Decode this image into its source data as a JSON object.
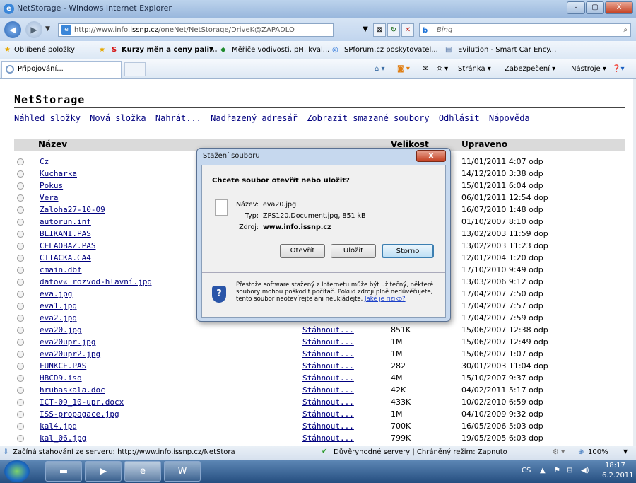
{
  "window": {
    "title": "NetStorage - Windows Internet Explorer",
    "min": "–",
    "max": "▢",
    "close": "X"
  },
  "address": {
    "url_prefix": "http://www.info.",
    "url_host": "issnp.cz",
    "url_path": "/oneNet/NetStorage/DriveK@ZAPADLO",
    "search_placeholder": "Bing"
  },
  "favorites": {
    "label": "Oblíbené položky",
    "items": [
      "Kurzy měn a ceny pali...",
      "Měřiče vodivosti, pH, kval...",
      "ISPforum.cz poskytovatel...",
      "Evilution - Smart Car Ency..."
    ]
  },
  "tab": {
    "label": "Připojování..."
  },
  "commandbar": {
    "page": "Stránka ▾",
    "security": "Zabezpečení ▾",
    "tools": "Nástroje ▾"
  },
  "page": {
    "title": "NetStorage",
    "links": [
      "Náhled složky",
      "Nová složka",
      "Nahrát...",
      "Nadřazený adresář",
      "Zobrazit smazané soubory",
      "Odhlásit",
      "Nápověda"
    ],
    "headers": {
      "name": "Název",
      "size": "Velikost",
      "modified": "Upraveno"
    },
    "download_label": "Stáhnout...",
    "rows": [
      {
        "name": "Cz",
        "size": "",
        "modified": "11/01/2011 4:07 odp"
      },
      {
        "name": "Kucharka",
        "size": "",
        "modified": "14/12/2010 3:38 odp"
      },
      {
        "name": "Pokus",
        "size": "",
        "modified": "15/01/2011 6:04 odp"
      },
      {
        "name": "Vera",
        "size": "",
        "modified": "06/01/2011 12:54 dop"
      },
      {
        "name": "Zaloha27-10-09",
        "size": "",
        "modified": "16/07/2010 1:48 odp"
      },
      {
        "name": "autorun.inf",
        "size": "",
        "modified": "01/10/2007 8:10 odp"
      },
      {
        "name": "BLIKANI.PAS",
        "size": "",
        "modified": "13/02/2003 11:59 dop"
      },
      {
        "name": "CELAOBAZ.PAS",
        "size": "",
        "modified": "13/02/2003 11:23 dop"
      },
      {
        "name": "CITACKA.CA4",
        "size": "",
        "modified": "12/01/2004 1:20 dop"
      },
      {
        "name": "cmain.dbf",
        "size": "",
        "modified": "17/10/2010 9:49 odp"
      },
      {
        "name": "datov« rozvod-hlavní.jpg",
        "size": "",
        "modified": "13/03/2006 9:12 odp"
      },
      {
        "name": "eva.jpg",
        "size": "",
        "modified": "17/04/2007 7:50 odp"
      },
      {
        "name": "eva1.jpg",
        "size": "",
        "modified": "17/04/2007 7:57 odp"
      },
      {
        "name": "eva2.jpg",
        "size": "",
        "modified": "17/04/2007 7:59 odp"
      },
      {
        "name": "eva20.jpg",
        "size": "851K",
        "modified": "15/06/2007 12:38 odp"
      },
      {
        "name": "eva20upr.jpg",
        "size": "1M",
        "modified": "15/06/2007 12:49 odp"
      },
      {
        "name": "eva20upr2.jpg",
        "size": "1M",
        "modified": "15/06/2007 1:07 odp"
      },
      {
        "name": "FUNKCE.PAS",
        "size": "282",
        "modified": "30/01/2003 11:04 dop"
      },
      {
        "name": "HBCD9.iso",
        "size": "4M",
        "modified": "15/10/2007 9:37 odp"
      },
      {
        "name": "hrubaskala.doc",
        "size": "42K",
        "modified": "04/02/2011 5:17 odp"
      },
      {
        "name": "ICT-09_10-upr.docx",
        "size": "433K",
        "modified": "10/02/2010 6:59 odp"
      },
      {
        "name": "ISS-propagace.jpg",
        "size": "1M",
        "modified": "04/10/2009 9:32 odp"
      },
      {
        "name": "kal4.jpg",
        "size": "700K",
        "modified": "16/05/2006 5:03 odp"
      },
      {
        "name": "kal_06.jpg",
        "size": "799K",
        "modified": "19/05/2005 6:03 dop"
      }
    ]
  },
  "dialog": {
    "title": "Stažení souboru",
    "close": "X",
    "question": "Chcete soubor otevřít nebo uložit?",
    "name_label": "Název:",
    "name_value": "eva20.jpg",
    "type_label": "Typ:",
    "type_value": "ZPS120.Document.jpg, 851 kB",
    "source_label": "Zdroj:",
    "source_value": "www.info.issnp.cz",
    "open": "Otevřít",
    "save": "Uložit",
    "cancel": "Storno",
    "warning": "Přestože software stažený z Internetu může být užitečný, některé soubory mohou poškodit počítač. Pokud zdroji plně nedůvěřujete, tento soubor neotevírejte ani neukládejte.",
    "risk_link": "Jaké je riziko?"
  },
  "status": {
    "text": "Začíná stahování ze serveru: http://www.info.issnp.cz/NetStora",
    "zone": "Důvěryhodné servery | Chráněný režim: Zapnuto",
    "zoom": "100%"
  },
  "taskbar": {
    "lang": "CS",
    "time": "18:17",
    "date": "6.2.2011"
  }
}
